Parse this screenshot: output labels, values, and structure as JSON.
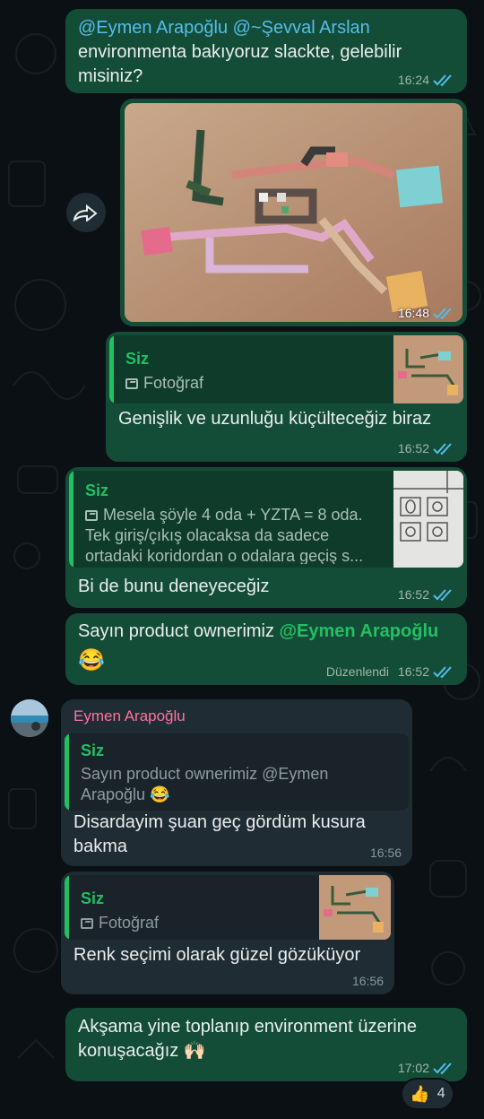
{
  "messages": {
    "m1": {
      "mention1": "@Eymen Arapoğlu",
      "mention2": "@~Şevval Arslan",
      "text": "environmenta bakıyoruz slackte, gelebilir misiniz?",
      "time": "16:24"
    },
    "m2": {
      "time": "16:48"
    },
    "m3": {
      "quote_author": "Siz",
      "quote_text": "Fotoğraf",
      "text": "Genişlik ve uzunluğu küçülteceğiz biraz",
      "time": "16:52"
    },
    "m4": {
      "quote_author": "Siz",
      "quote_text": "Mesela şöyle 4 oda + YZTA = 8 oda. Tek giriş/çıkış olacaksa da sadece ortadaki koridordan o odalara geçiş s...",
      "text": "Bi de bunu deneyeceğiz",
      "time": "16:52"
    },
    "m5": {
      "text": "Sayın product ownerimiz",
      "mention": "@Eymen Arapoğlu",
      "emoji": "😂",
      "edited": "Düzenlendi",
      "time": "16:52"
    },
    "m6": {
      "sender": "Eymen Arapoğlu",
      "quote_author": "Siz",
      "quote_text": "Sayın product ownerimiz @Eymen Arapoğlu 😂",
      "text": "Disardayim şuan geç gördüm kusura bakma",
      "time": "16:56"
    },
    "m7": {
      "quote_author": "Siz",
      "quote_text": "Fotoğraf",
      "text": "Renk seçimi olarak güzel gözüküyor",
      "time": "16:56"
    },
    "m8": {
      "text": "Akşama yine toplanıp environment üzerine konuşacağız",
      "emoji": "🙌🏻",
      "time": "17:02",
      "reaction_emoji": "👍",
      "reaction_count": "4"
    }
  },
  "colors": {
    "outgoing_bubble": "#144d37",
    "incoming_bubble": "#1f2c33",
    "read_ticks": "#53bdeb",
    "quote_accent": "#21c063",
    "sender_name": "#ff72a1"
  },
  "icons": [
    "forward-icon",
    "photo-icon",
    "double-check-icon",
    "avatar"
  ]
}
